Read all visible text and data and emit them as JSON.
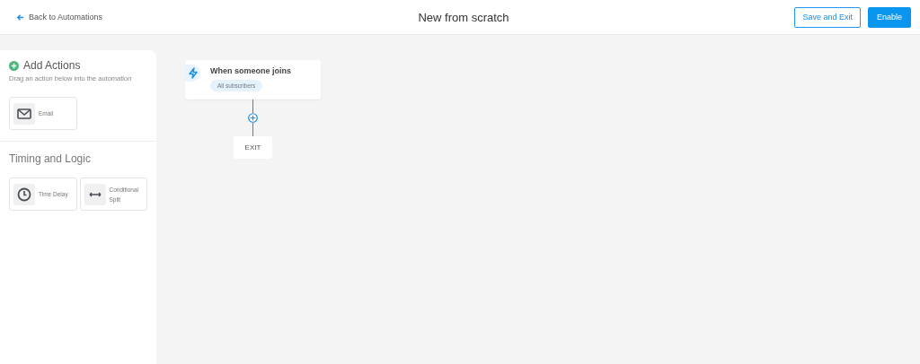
{
  "header": {
    "back_link": "Back to Automations",
    "title": "New from scratch",
    "buttons": [
      {
        "label": "Save and Exit",
        "kind": "outline"
      },
      {
        "label": "Enable",
        "kind": "primary"
      }
    ]
  },
  "sidebar": {
    "sections": [
      {
        "title": "Add Actions",
        "subtitle": "Drag an action below into the automation",
        "actions": [
          {
            "label": "Email",
            "kind": "email"
          }
        ]
      },
      {
        "title": "Timing and Logic",
        "actions": [
          {
            "label": "Time Delay",
            "kind": "delay"
          },
          {
            "label": "Conditional Split",
            "kind": "split"
          }
        ]
      }
    ]
  },
  "canvas": {
    "trigger": {
      "title": "When someone joins",
      "tag": "All subscribers"
    },
    "exit": "EXIT"
  }
}
